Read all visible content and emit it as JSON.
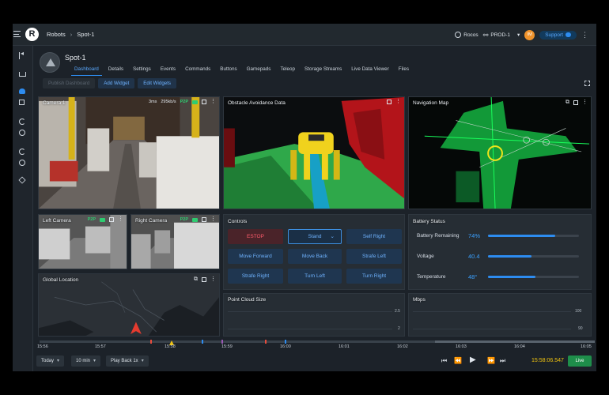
{
  "breadcrumb": {
    "root": "Robots",
    "current": "Spot-1"
  },
  "header": {
    "org": "Rocos",
    "env": "PROD-1",
    "avatar_initials": "IM",
    "support_label": "Support"
  },
  "robot": {
    "name": "Spot-1"
  },
  "tabs": [
    {
      "label": "Dashboard",
      "active": true
    },
    {
      "label": "Details"
    },
    {
      "label": "Settings"
    },
    {
      "label": "Events"
    },
    {
      "label": "Commands"
    },
    {
      "label": "Buttons"
    },
    {
      "label": "Gamepads"
    },
    {
      "label": "Teleop"
    },
    {
      "label": "Storage Streams"
    },
    {
      "label": "Live Data Viewer"
    },
    {
      "label": "Files"
    }
  ],
  "actions": {
    "save": "Publish Dashboard",
    "add": "Add Widget",
    "edit": "Edit Widgets"
  },
  "camera1": {
    "title": "Camera 1",
    "latency": "3ms",
    "bitrate": "295kb/s",
    "mode": "P2P"
  },
  "obstacle": {
    "title": "Obstacle Avoidance Data"
  },
  "navmap": {
    "title": "Navigation Map"
  },
  "left_camera": {
    "title": "Left Camera",
    "mode": "P2P"
  },
  "right_camera": {
    "title": "Right Camera",
    "mode": "P2P"
  },
  "global_location": {
    "title": "Global Location"
  },
  "controls": {
    "title": "Controls",
    "estop": "ESTOP",
    "stand": "Stand",
    "self_right": "Self Right",
    "move_forward": "Move Forward",
    "move_back": "Move Back",
    "strafe_left": "Strafe Left",
    "strafe_right": "Strafe Right",
    "turn_left": "Turn Left",
    "turn_right": "Turn Right"
  },
  "battery": {
    "title": "Battery Status",
    "rows": [
      {
        "label": "Battery Remaining",
        "value": "74%",
        "level": 0.74
      },
      {
        "label": "Voltage",
        "value": "40.4",
        "level": 0.48
      },
      {
        "label": "Temperature",
        "value": "48°",
        "level": 0.52
      }
    ]
  },
  "point_cloud": {
    "title": "Point Cloud Size",
    "ticks": [
      "2.5",
      "2"
    ]
  },
  "mbps": {
    "title": "Mbps",
    "ticks": [
      "100",
      "90"
    ]
  },
  "timeline": {
    "ticks": [
      "15:56",
      "15:57",
      "15:58",
      "15:59",
      "16:00",
      "16:01",
      "16:02",
      "16:03",
      "16:04",
      "16:05"
    ],
    "range": "Today",
    "window": "10 min",
    "playback": "Play Back 1x",
    "current_time": "15:58:06.547",
    "live": "Live"
  },
  "colors": {
    "accent": "#2d8cf0",
    "estop": "#ff5c6c",
    "live": "#1e8e4a",
    "time": "#f1c40f"
  }
}
